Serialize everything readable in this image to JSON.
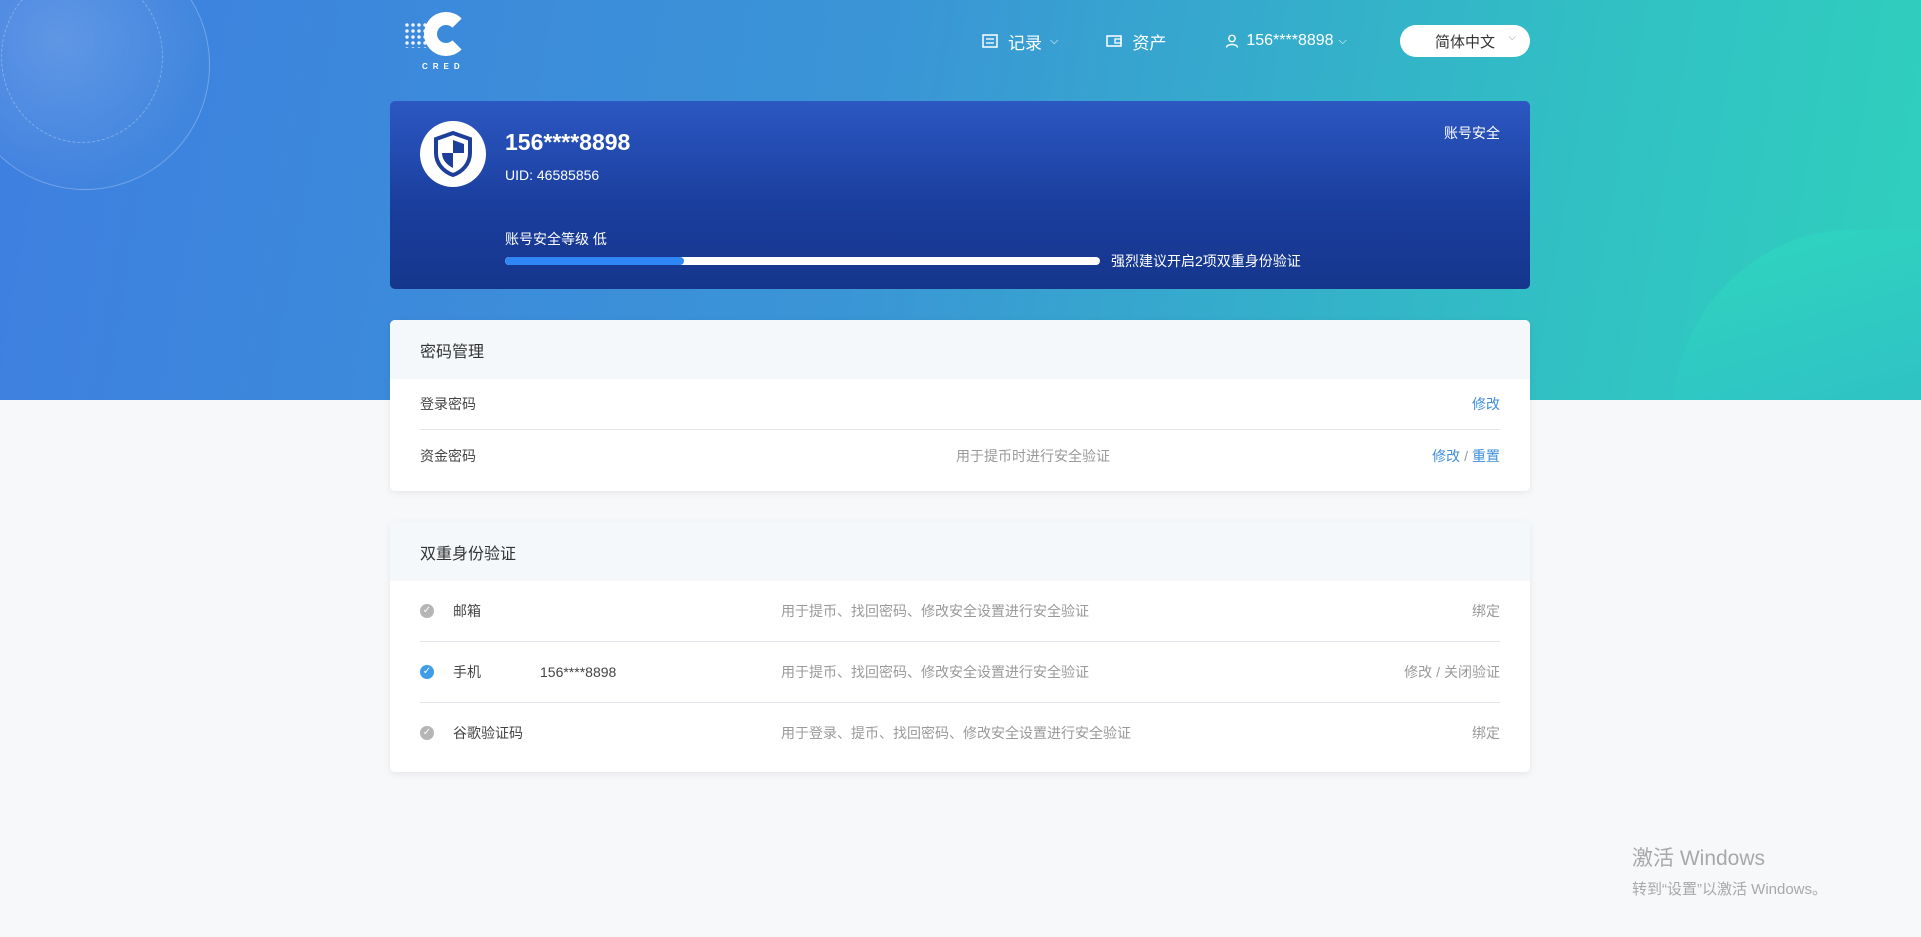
{
  "header": {
    "logo_text": "CRED",
    "nav": {
      "records_label": "记录",
      "assets_label": "资产",
      "user_label": "156****8898"
    },
    "language": "简体中文"
  },
  "security_card": {
    "username": "156****8898",
    "uid": "UID: 46585856",
    "account_security_link": "账号安全",
    "level_text": "账号安全等级 低",
    "progress_fraction": 0.3,
    "tip": "强烈建议开启2项双重身份验证"
  },
  "password_panel": {
    "title": "密码管理",
    "rows": [
      {
        "label": "登录密码",
        "desc": "",
        "action": "修改"
      },
      {
        "label": "资金密码",
        "desc": "用于提币时进行安全验证",
        "action_modify": "修改",
        "sep": "/",
        "action_reset": "重置"
      }
    ]
  },
  "twofa_panel": {
    "title": "双重身份验证",
    "rows": [
      {
        "label": "邮箱",
        "value": "",
        "desc": "用于提币、找回密码、修改安全设置进行安全验证",
        "action": "绑定",
        "enabled": false
      },
      {
        "label": "手机",
        "value": "156****8898",
        "desc": "用于提币、找回密码、修改安全设置进行安全验证",
        "action_modify": "修改",
        "sep": "/",
        "action_close": "关闭验证",
        "enabled": true
      },
      {
        "label": "谷歌验证码",
        "value": "",
        "desc": "用于登录、提币、找回密码、修改安全设置进行安全验证",
        "action": "绑定",
        "enabled": false
      }
    ]
  },
  "watermark": {
    "line1": "激活 Windows",
    "line2": "转到“设置”以激活 Windows。"
  },
  "colors": {
    "accent_blue": "#3f8fd9",
    "progress_fill": "#2f86f6",
    "card_blue": "#1a3e9e"
  }
}
